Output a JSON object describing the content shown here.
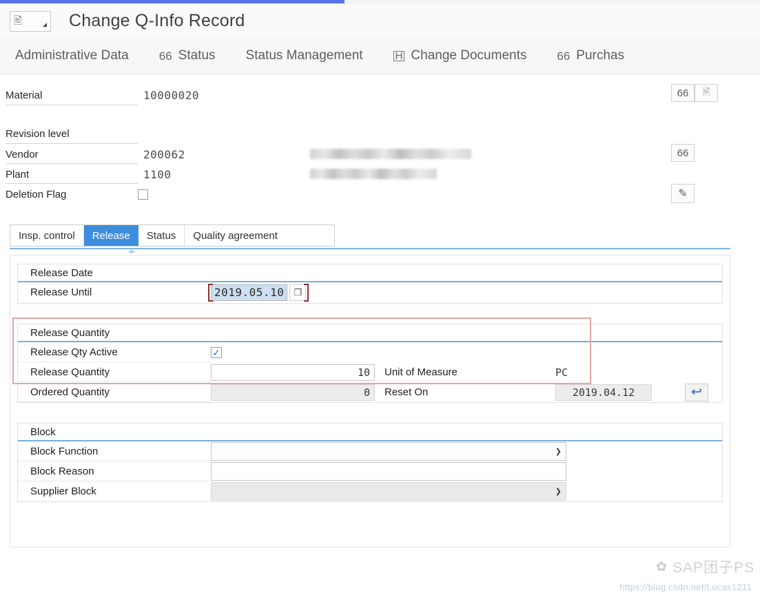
{
  "window": {
    "title": "Change Q-Info Record",
    "app_icon": "record-card-icon"
  },
  "nav": {
    "items": [
      {
        "label": "Administrative Data",
        "icon": ""
      },
      {
        "label": "Status",
        "icon": "66"
      },
      {
        "label": "Status Management",
        "icon": ""
      },
      {
        "label": "Change Documents",
        "icon": "H"
      },
      {
        "label": "Purchas",
        "icon": "66"
      }
    ]
  },
  "header": {
    "material": {
      "label": "Material",
      "value": "10000020"
    },
    "revision_level": {
      "label": "Revision level",
      "value": ""
    },
    "vendor": {
      "label": "Vendor",
      "value": "200062",
      "name_redacted": true
    },
    "plant": {
      "label": "Plant",
      "value": "1100",
      "name_redacted": true
    },
    "deletion_flag": {
      "label": "Deletion Flag",
      "checked": false
    },
    "buttons": [
      {
        "name": "display-material-button",
        "icon": "66"
      },
      {
        "name": "material-detail-button",
        "icon": "card"
      },
      {
        "name": "display-vendor-button",
        "icon": "66"
      },
      {
        "name": "edit-deletion-button",
        "icon": "edit-doc"
      }
    ]
  },
  "subtabs": {
    "items": [
      {
        "label": "Insp. control",
        "active": false
      },
      {
        "label": "Release",
        "active": true
      },
      {
        "label": "Status",
        "active": false
      },
      {
        "label": "Quality agreement",
        "active": false
      }
    ]
  },
  "release_date_group": {
    "title": "Release Date",
    "release_until": {
      "label": "Release Until",
      "value": "2019.05.10",
      "focused": true,
      "copy_button": "copy-icon"
    }
  },
  "release_quantity_group": {
    "title": "Release Quantity",
    "qty_active": {
      "label": "Release Qty Active",
      "checked": true
    },
    "release_quantity": {
      "label": "Release Quantity",
      "value": "10"
    },
    "unit_of_measure": {
      "label": "Unit of Measure",
      "value": "PC"
    },
    "ordered_quantity": {
      "label": "Ordered Quantity",
      "value": "0"
    },
    "reset_on": {
      "label": "Reset On",
      "value": "2019.04.12"
    },
    "undo_button": "undo-icon"
  },
  "block_group": {
    "title": "Block",
    "block_function": {
      "label": "Block Function",
      "value": ""
    },
    "block_reason": {
      "label": "Block Reason",
      "value": ""
    },
    "supplier_block": {
      "label": "Supplier Block",
      "value": ""
    }
  },
  "watermark": {
    "mark": "✿",
    "text": "SAP团子PS",
    "url": "https://blog.csdn.net/Lucas1211"
  },
  "colors": {
    "accent_blue": "#5a74e8",
    "active_tab_blue": "#3d8ddd",
    "separator_blue": "#74afe0",
    "annotation_red": "#e2a5a5",
    "focus_bracket_red": "#8f2d2d"
  }
}
